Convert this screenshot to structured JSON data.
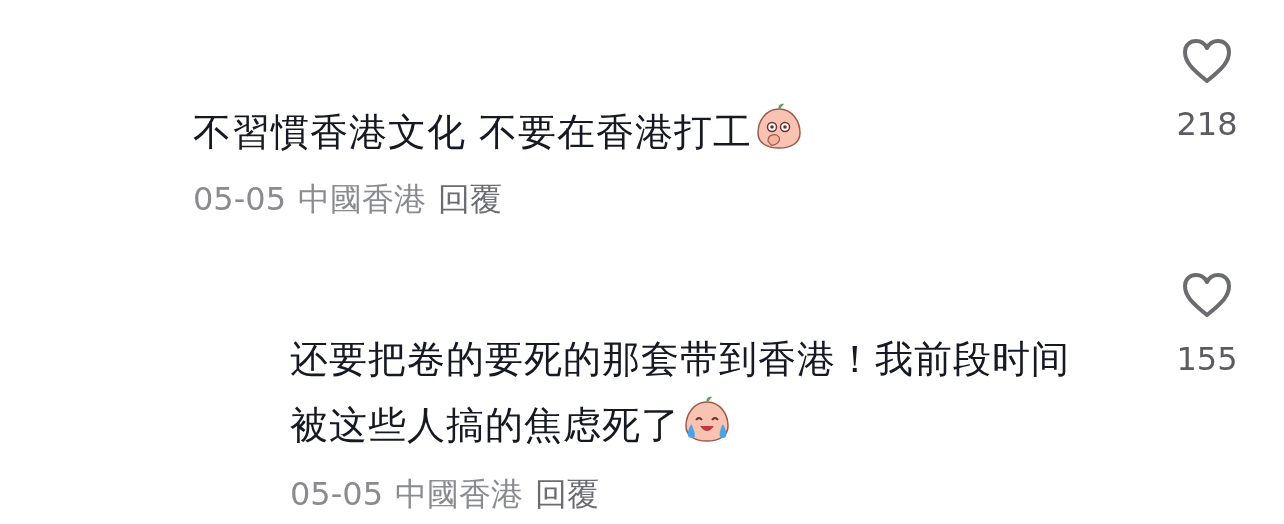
{
  "comments": [
    {
      "text": "不習慣香港文化 不要在香港打工",
      "date": "05-05",
      "location": "中國香港",
      "reply_label": "回覆",
      "likes": "218",
      "liked": false,
      "replies": [
        {
          "text": "还要把卷的要死的那套带到香港！我前段时间被这些人搞的焦虑死了",
          "date": "05-05",
          "location": "中國香港",
          "reply_label": "回覆",
          "likes": "155",
          "liked": false
        }
      ]
    }
  ]
}
